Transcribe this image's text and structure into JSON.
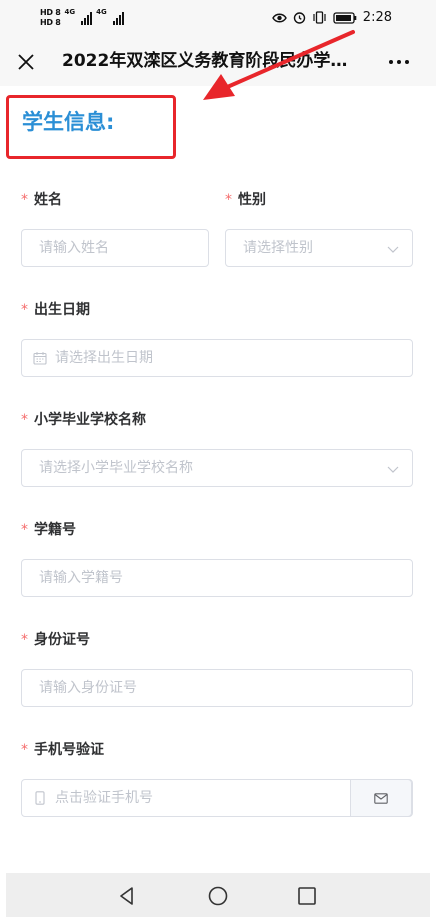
{
  "status_bar": {
    "hd_top": "HD 8",
    "hd_bottom": "HD 8",
    "net1": "4G",
    "net2": "4G",
    "time": "2:28"
  },
  "title_bar": {
    "title": "2022年双滦区义务教育阶段民办学…"
  },
  "section": {
    "title": "学生信息:"
  },
  "form": {
    "required_mark": "*",
    "name": {
      "label": "姓名",
      "placeholder": "请输入姓名"
    },
    "gender": {
      "label": "性别",
      "placeholder": "请选择性别"
    },
    "birth": {
      "label": "出生日期",
      "placeholder": "请选择出生日期"
    },
    "school": {
      "label": "小学毕业学校名称",
      "placeholder": "请选择小学毕业学校名称"
    },
    "student_id": {
      "label": "学籍号",
      "placeholder": "请输入学籍号"
    },
    "id_card": {
      "label": "身份证号",
      "placeholder": "请输入身份证号"
    },
    "phone": {
      "label": "手机号验证",
      "placeholder": "点击验证手机号"
    }
  },
  "colors": {
    "section_title": "#2b8fd6",
    "annotation_red": "#e8262b",
    "required": "#f56c6c",
    "border": "#dcdfe6",
    "placeholder": "#c0c4cc"
  },
  "icons": [
    "close-icon",
    "more-icon",
    "calendar-icon",
    "chevron-down-icon",
    "phone-icon",
    "mail-icon",
    "back-icon",
    "home-icon",
    "recents-icon",
    "eye-icon",
    "alarm-icon",
    "vibrate-icon",
    "battery-icon"
  ]
}
